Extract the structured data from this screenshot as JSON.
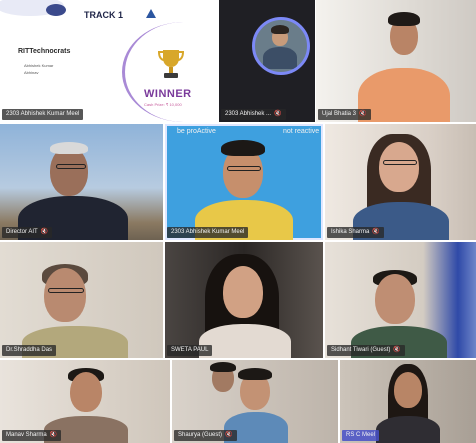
{
  "participants": [
    {
      "name": "2303 Abhishek Kumar Meel",
      "mic": "muted"
    },
    {
      "name": "2303 Abhishek ...",
      "mic": "muted"
    },
    {
      "name": "Ujjal Bhatia",
      "mic": "muted",
      "name_display": "Ujal Bhatia 3"
    },
    {
      "name": "Director AIT",
      "mic": "muted"
    },
    {
      "name": "2303 Abhishek Kumar Meel",
      "mic": "muted"
    },
    {
      "name": "Ishika Sharma",
      "mic": "muted"
    },
    {
      "name": "Dr.Shraddha Das",
      "mic": "muted"
    },
    {
      "name": "SWETA PAUL",
      "mic": "muted"
    },
    {
      "name": "Sidhant Tiwari (Guest)",
      "mic": "muted"
    },
    {
      "name": "Manav Sharma",
      "mic": "muted"
    },
    {
      "name": "Shaurya (Guest)",
      "mic": "muted"
    },
    {
      "name": "RS C Meel",
      "mic": "muted"
    }
  ],
  "slide": {
    "track": "TRACK 1",
    "team": "RITTechnocrats",
    "members": [
      "Abhishek Kumar",
      "Abhinav"
    ],
    "winner": "WINNER",
    "prize": "Cash Prize: ₹ 10,000"
  },
  "background_text": {
    "left": "be proActive",
    "right": "not reactive"
  },
  "icons": {
    "mic_muted": "mic-muted-icon",
    "trophy": "trophy-icon",
    "logo": "logo-icon"
  },
  "colors": {
    "label_bg": "#2b2b2b",
    "accent_purple": "#7a3a9b",
    "ring_blue": "#7c89f6",
    "sky_blue": "#46a4e0"
  }
}
